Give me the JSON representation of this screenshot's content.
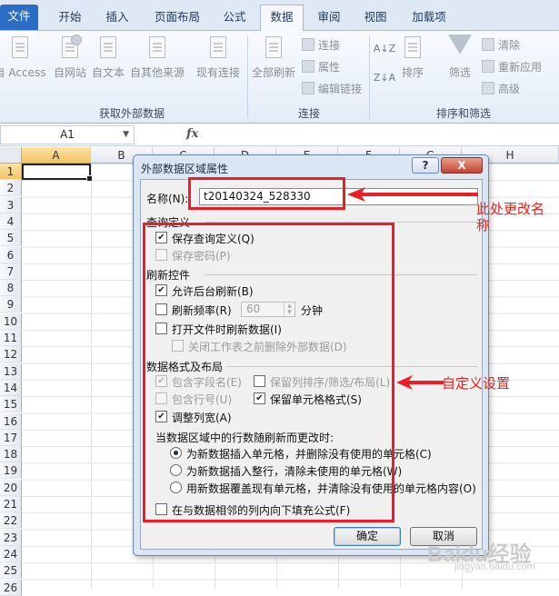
{
  "ribbon": {
    "tabs": [
      "文件",
      "开始",
      "插入",
      "页面布局",
      "公式",
      "数据",
      "审阅",
      "视图",
      "加载项"
    ],
    "active_tab": "数据",
    "get_external": {
      "buttons": [
        "自 Access",
        "自网站",
        "自文本",
        "自其他来源",
        "现有连接"
      ],
      "group_label": "获取外部数据"
    },
    "connections": {
      "refresh_all": "全部刷新",
      "items": [
        "连接",
        "属性",
        "编辑链接"
      ],
      "group_label": "连接"
    },
    "sort_filter": {
      "sort": "排序",
      "filter": "筛选",
      "items": [
        "清除",
        "重新应用",
        "高级"
      ],
      "group_label": "排序和筛选"
    }
  },
  "formula_bar": {
    "name_box": "A1",
    "fx": "fx"
  },
  "grid": {
    "columns": [
      "A",
      "B",
      "C",
      "D",
      "E",
      "F",
      "G",
      "H"
    ],
    "rows": [
      "1",
      "2",
      "3",
      "4",
      "5",
      "6",
      "7",
      "8",
      "9",
      "10",
      "11",
      "12",
      "13",
      "14",
      "15",
      "16",
      "17",
      "18",
      "19",
      "20",
      "21",
      "22",
      "23",
      "24",
      "25",
      "26"
    ]
  },
  "dialog": {
    "title": "外部数据区域属性",
    "help": "?",
    "close": "X",
    "name_label": "名称(N):",
    "name_value": "t20140324_528330",
    "query_section": "查询定义",
    "save_query": "保存查询定义(Q)",
    "save_password": "保存密码(P)",
    "refresh_section": "刷新控件",
    "background_refresh": "允许后台刷新(B)",
    "refresh_every": "刷新频率(R)",
    "refresh_minutes": "60",
    "minutes_unit": "分钟",
    "refresh_on_open": "打开文件时刷新数据(I)",
    "remove_external": "关闭工作表之前删除外部数据(D)",
    "format_section": "数据格式及布局",
    "include_field_names": "包含字段名(E)",
    "preserve_sort": "保留列排序/筛选/布局(L)",
    "include_row_numbers": "包含行号(U)",
    "preserve_cell_format": "保留单元格格式(S)",
    "adjust_column_width": "调整列宽(A)",
    "rows_change_label": "当数据区域中的行数随刷新而更改时:",
    "radio_insert_cells": "为新数据插入单元格，并删除没有使用的单元格(C)",
    "radio_insert_rows": "为新数据插入整行，清除未使用的单元格(W)",
    "radio_overwrite": "用新数据覆盖现有单元格，并清除没有使用的单元格内容(O)",
    "fill_formulas": "在与数据相邻的列内向下填充公式(F)",
    "ok": "确定",
    "cancel": "取消"
  },
  "annotations": {
    "rename_note": "此处更改名称",
    "custom_note": "自定义设置",
    "color": "#ee1c24"
  },
  "watermark": {
    "text": "Baidu经验",
    "sub": "jingyan.baidu.com"
  }
}
